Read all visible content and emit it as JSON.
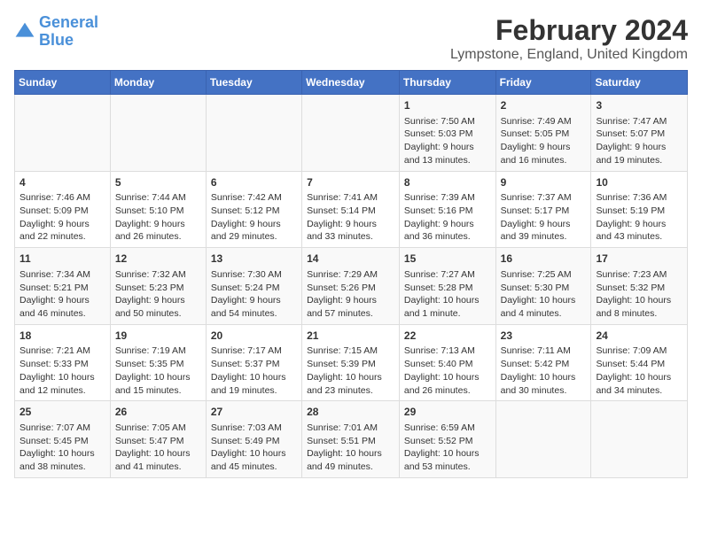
{
  "header": {
    "logo_line1": "General",
    "logo_line2": "Blue",
    "title": "February 2024",
    "subtitle": "Lympstone, England, United Kingdom"
  },
  "weekdays": [
    "Sunday",
    "Monday",
    "Tuesday",
    "Wednesday",
    "Thursday",
    "Friday",
    "Saturday"
  ],
  "weeks": [
    [
      {
        "day": "",
        "content": ""
      },
      {
        "day": "",
        "content": ""
      },
      {
        "day": "",
        "content": ""
      },
      {
        "day": "",
        "content": ""
      },
      {
        "day": "1",
        "content": "Sunrise: 7:50 AM\nSunset: 5:03 PM\nDaylight: 9 hours\nand 13 minutes."
      },
      {
        "day": "2",
        "content": "Sunrise: 7:49 AM\nSunset: 5:05 PM\nDaylight: 9 hours\nand 16 minutes."
      },
      {
        "day": "3",
        "content": "Sunrise: 7:47 AM\nSunset: 5:07 PM\nDaylight: 9 hours\nand 19 minutes."
      }
    ],
    [
      {
        "day": "4",
        "content": "Sunrise: 7:46 AM\nSunset: 5:09 PM\nDaylight: 9 hours\nand 22 minutes."
      },
      {
        "day": "5",
        "content": "Sunrise: 7:44 AM\nSunset: 5:10 PM\nDaylight: 9 hours\nand 26 minutes."
      },
      {
        "day": "6",
        "content": "Sunrise: 7:42 AM\nSunset: 5:12 PM\nDaylight: 9 hours\nand 29 minutes."
      },
      {
        "day": "7",
        "content": "Sunrise: 7:41 AM\nSunset: 5:14 PM\nDaylight: 9 hours\nand 33 minutes."
      },
      {
        "day": "8",
        "content": "Sunrise: 7:39 AM\nSunset: 5:16 PM\nDaylight: 9 hours\nand 36 minutes."
      },
      {
        "day": "9",
        "content": "Sunrise: 7:37 AM\nSunset: 5:17 PM\nDaylight: 9 hours\nand 39 minutes."
      },
      {
        "day": "10",
        "content": "Sunrise: 7:36 AM\nSunset: 5:19 PM\nDaylight: 9 hours\nand 43 minutes."
      }
    ],
    [
      {
        "day": "11",
        "content": "Sunrise: 7:34 AM\nSunset: 5:21 PM\nDaylight: 9 hours\nand 46 minutes."
      },
      {
        "day": "12",
        "content": "Sunrise: 7:32 AM\nSunset: 5:23 PM\nDaylight: 9 hours\nand 50 minutes."
      },
      {
        "day": "13",
        "content": "Sunrise: 7:30 AM\nSunset: 5:24 PM\nDaylight: 9 hours\nand 54 minutes."
      },
      {
        "day": "14",
        "content": "Sunrise: 7:29 AM\nSunset: 5:26 PM\nDaylight: 9 hours\nand 57 minutes."
      },
      {
        "day": "15",
        "content": "Sunrise: 7:27 AM\nSunset: 5:28 PM\nDaylight: 10 hours\nand 1 minute."
      },
      {
        "day": "16",
        "content": "Sunrise: 7:25 AM\nSunset: 5:30 PM\nDaylight: 10 hours\nand 4 minutes."
      },
      {
        "day": "17",
        "content": "Sunrise: 7:23 AM\nSunset: 5:32 PM\nDaylight: 10 hours\nand 8 minutes."
      }
    ],
    [
      {
        "day": "18",
        "content": "Sunrise: 7:21 AM\nSunset: 5:33 PM\nDaylight: 10 hours\nand 12 minutes."
      },
      {
        "day": "19",
        "content": "Sunrise: 7:19 AM\nSunset: 5:35 PM\nDaylight: 10 hours\nand 15 minutes."
      },
      {
        "day": "20",
        "content": "Sunrise: 7:17 AM\nSunset: 5:37 PM\nDaylight: 10 hours\nand 19 minutes."
      },
      {
        "day": "21",
        "content": "Sunrise: 7:15 AM\nSunset: 5:39 PM\nDaylight: 10 hours\nand 23 minutes."
      },
      {
        "day": "22",
        "content": "Sunrise: 7:13 AM\nSunset: 5:40 PM\nDaylight: 10 hours\nand 26 minutes."
      },
      {
        "day": "23",
        "content": "Sunrise: 7:11 AM\nSunset: 5:42 PM\nDaylight: 10 hours\nand 30 minutes."
      },
      {
        "day": "24",
        "content": "Sunrise: 7:09 AM\nSunset: 5:44 PM\nDaylight: 10 hours\nand 34 minutes."
      }
    ],
    [
      {
        "day": "25",
        "content": "Sunrise: 7:07 AM\nSunset: 5:45 PM\nDaylight: 10 hours\nand 38 minutes."
      },
      {
        "day": "26",
        "content": "Sunrise: 7:05 AM\nSunset: 5:47 PM\nDaylight: 10 hours\nand 41 minutes."
      },
      {
        "day": "27",
        "content": "Sunrise: 7:03 AM\nSunset: 5:49 PM\nDaylight: 10 hours\nand 45 minutes."
      },
      {
        "day": "28",
        "content": "Sunrise: 7:01 AM\nSunset: 5:51 PM\nDaylight: 10 hours\nand 49 minutes."
      },
      {
        "day": "29",
        "content": "Sunrise: 6:59 AM\nSunset: 5:52 PM\nDaylight: 10 hours\nand 53 minutes."
      },
      {
        "day": "",
        "content": ""
      },
      {
        "day": "",
        "content": ""
      }
    ]
  ]
}
